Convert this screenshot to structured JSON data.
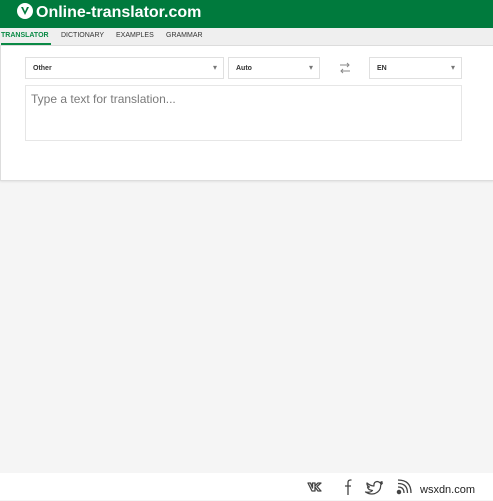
{
  "brand": {
    "name": "Online-translator.com",
    "color": "#007a3d",
    "logo_icon": "v-check-icon"
  },
  "nav": {
    "tabs": [
      {
        "label": "TRANSLATOR",
        "active": true
      },
      {
        "label": "DICTIONARY",
        "active": false
      },
      {
        "label": "EXAMPLES",
        "active": false
      },
      {
        "label": "GRAMMAR",
        "active": false
      }
    ],
    "active_color": "#0a8a45"
  },
  "translator": {
    "category_select": "Other",
    "source_language": "Auto",
    "swap_icon": "swap-arrows-icon",
    "target_language": "EN",
    "input_placeholder": "Type a text for translation..."
  },
  "footer": {
    "social_icons": [
      "vk-icon",
      "facebook-icon",
      "twitter-icon",
      "rss-icon"
    ],
    "watermark": "wsxdn.com"
  }
}
